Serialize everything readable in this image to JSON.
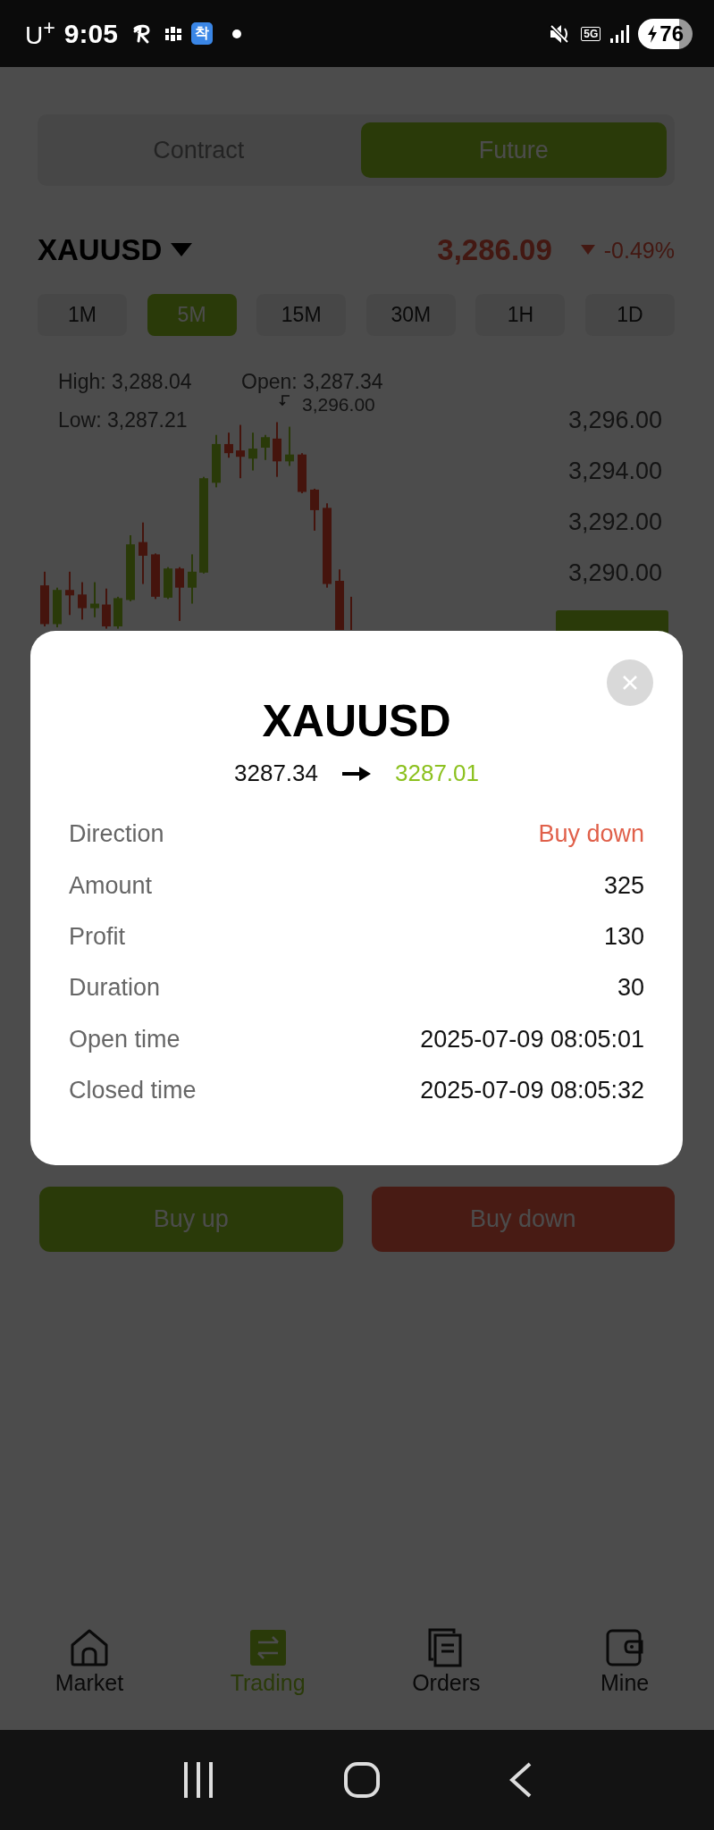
{
  "status_bar": {
    "carrier": "U$^{+}$",
    "time": "9:05",
    "app_badge": "착",
    "network": "5G",
    "battery": "76"
  },
  "tabs": [
    {
      "label": "Contract",
      "selected": false
    },
    {
      "label": "Future",
      "selected": true
    }
  ],
  "ticker": {
    "symbol": "XAUUSD",
    "price": "3,286.09",
    "change": "-0.49%"
  },
  "timeframes": [
    {
      "label": "1M",
      "selected": false
    },
    {
      "label": "5M",
      "selected": true
    },
    {
      "label": "15M",
      "selected": false
    },
    {
      "label": "30M",
      "selected": false
    },
    {
      "label": "1H",
      "selected": false
    },
    {
      "label": "1D",
      "selected": false
    }
  ],
  "chart": {
    "stats": [
      "High: 3,288.04",
      "Open: 3,287.34",
      "Low: 3,287.21"
    ],
    "peak_label": "3,296.00",
    "axis_labels": [
      "3,296.00",
      "3,294.00",
      "3,292.00",
      "3,290.00"
    ]
  },
  "dialog": {
    "title": "XAUUSD",
    "open_price": "3287.34",
    "close_price": "3287.01",
    "rows": [
      {
        "label": "Direction",
        "value": "Buy down",
        "color": "#e0604a"
      },
      {
        "label": "Amount",
        "value": "325",
        "color": "#111111"
      },
      {
        "label": "Profit",
        "value": "130",
        "color": "#111111"
      },
      {
        "label": "Duration",
        "value": "30",
        "color": "#111111"
      },
      {
        "label": "Open time",
        "value": "2025-07-09 08:05:01",
        "color": "#111111"
      },
      {
        "label": "Closed time",
        "value": "2025-07-09 08:05:32",
        "color": "#111111"
      }
    ]
  },
  "actions": [
    {
      "label": "Buy up",
      "kind": "up"
    },
    {
      "label": "Buy down",
      "kind": "down"
    }
  ],
  "bottom_nav": [
    {
      "label": "Market",
      "selected": false
    },
    {
      "label": "Trading",
      "selected": true
    },
    {
      "label": "Orders",
      "selected": false
    },
    {
      "label": "Mine",
      "selected": false
    }
  ]
}
